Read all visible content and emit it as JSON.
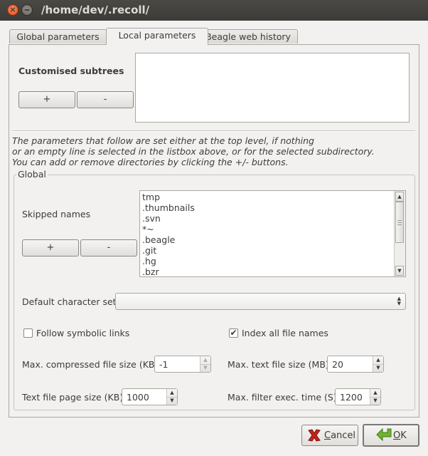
{
  "window": {
    "title": "/home/dev/.recoll/"
  },
  "tabs": [
    {
      "label": "Global parameters"
    },
    {
      "label": "Local parameters"
    },
    {
      "label": "Beagle web history"
    }
  ],
  "subtrees": {
    "label": "Customised subtrees",
    "add_label": "+",
    "remove_label": "-"
  },
  "info_lines": [
    "The parameters that follow are set either at the top level, if nothing",
    "or an empty line is selected in the listbox above, or for the selected subdirectory.",
    "You can add or remove directories by clicking the +/- buttons."
  ],
  "global_group": {
    "title": "Global",
    "skipped": {
      "label": "Skipped names",
      "add_label": "+",
      "remove_label": "-",
      "items": [
        "tmp",
        ".thumbnails",
        ".svn",
        "*~",
        ".beagle",
        ".git",
        ".hg",
        ".bzr"
      ]
    },
    "charset": {
      "label": "Default character set",
      "value": ""
    },
    "follow_links": {
      "label": "Follow symbolic links",
      "checked": false
    },
    "index_all": {
      "label": "Index all file names",
      "checked": true,
      "mark": "✔"
    },
    "max_compressed": {
      "label": "Max. compressed file size (KB)",
      "value": "-1"
    },
    "max_text": {
      "label": "Max. text file size (MB)",
      "value": "20"
    },
    "page_size": {
      "label": "Text file page size (KB)",
      "value": "1000"
    },
    "max_filter": {
      "label": "Max. filter exec. time (S)",
      "value": "1200"
    }
  },
  "buttons": {
    "cancel_first": "C",
    "cancel_rest": "ancel",
    "ok_first": "O",
    "ok_rest": "K"
  },
  "icons": {
    "close": "close-icon",
    "minimize": "minimize-icon",
    "cancel": "cancel-x-icon",
    "ok": "ok-arrow-icon"
  },
  "colors": {
    "titlebar": "#3c3b37",
    "close_button": "#e5501d",
    "cancel_icon": "#c4231c",
    "ok_icon": "#4e9a06"
  }
}
